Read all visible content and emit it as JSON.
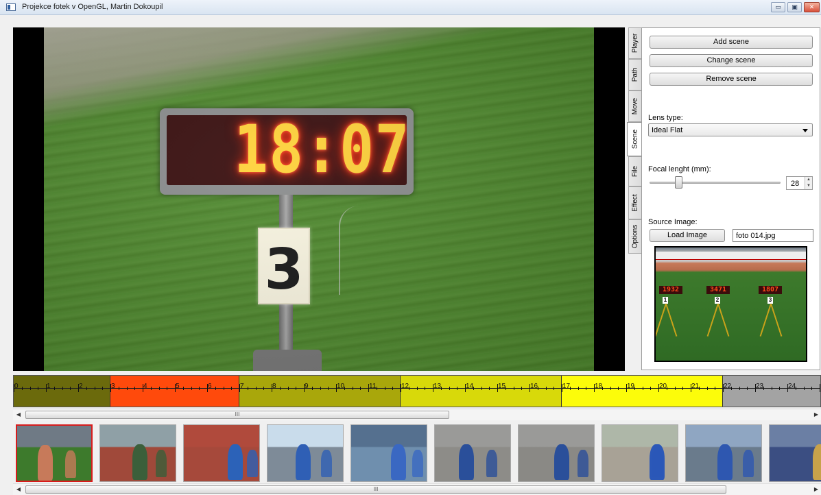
{
  "window": {
    "title": "Projekce fotek v OpenGL, Martin Dokoupil",
    "controls": {
      "minimize": "▭",
      "maximize": "▣",
      "close": "✕"
    }
  },
  "viewport": {
    "clock_digits": "18:07",
    "card_number": "3"
  },
  "tabs": [
    "Player",
    "Path",
    "Move",
    "Scene",
    "File",
    "Effect",
    "Options"
  ],
  "active_tab": "Scene",
  "scene": {
    "add_label": "Add scene",
    "change_label": "Change scene",
    "remove_label": "Remove scene",
    "lens_type_label": "Lens type:",
    "lens_type_value": "Ideal Flat",
    "focal_label": "Focal lenght (mm):",
    "focal_value": "28",
    "focal_fraction": 0.22,
    "source_label": "Source Image:",
    "load_label": "Load Image",
    "source_file": "foto 014.jpg",
    "preview": {
      "boards": [
        "1932",
        "3471",
        "1807"
      ],
      "cards": [
        "1",
        "2",
        "3"
      ]
    }
  },
  "timeline": {
    "ticks": [
      "0",
      "1",
      "2",
      "3",
      "4",
      "5",
      "6",
      "7",
      "8",
      "9",
      "10",
      "11",
      "12",
      "13",
      "14",
      "15",
      "16",
      "17",
      "18",
      "19",
      "20",
      "21",
      "22",
      "23",
      "24",
      "2"
    ],
    "segments": [
      {
        "start": 0,
        "end": 3,
        "color": "#6b6a0c"
      },
      {
        "start": 3,
        "end": 7,
        "color": "#ff4a0c"
      },
      {
        "start": 7,
        "end": 12,
        "color": "#a9a70b"
      },
      {
        "start": 12,
        "end": 17,
        "color": "#d8d90a"
      },
      {
        "start": 17,
        "end": 22,
        "color": "#fcfc0a"
      },
      {
        "start": 22,
        "end": 25.2,
        "color": "#a3a3a3"
      }
    ],
    "scroll_fraction": 0.0
  },
  "thumbnails": [
    {
      "selected": true,
      "sky": "#6f7a85",
      "ground": "#3d7a2c",
      "accent": "#c77a5a"
    },
    {
      "selected": false,
      "sky": "#8fa0a6",
      "ground": "#a0493a",
      "accent": "#3b5f3a"
    },
    {
      "selected": false,
      "sky": "#b04a3c",
      "ground": "#a6493b",
      "accent": "#2c62b8"
    },
    {
      "selected": false,
      "sky": "#c9dceb",
      "ground": "#7e8b98",
      "accent": "#2f5fb5"
    },
    {
      "selected": false,
      "sky": "#55708f",
      "ground": "#6f8fae",
      "accent": "#3a68c2"
    },
    {
      "selected": false,
      "sky": "#9a9a98",
      "ground": "#8d8c88",
      "accent": "#2a4f9a"
    },
    {
      "selected": false,
      "sky": "#9a9a98",
      "ground": "#8a8985",
      "accent": "#2a4f9a"
    },
    {
      "selected": false,
      "sky": "#aeb7a8",
      "ground": "#a8a296",
      "accent": "#2b58b8"
    },
    {
      "selected": false,
      "sky": "#8fa6c2",
      "ground": "#6a7b8c",
      "accent": "#2e57b0"
    },
    {
      "selected": false,
      "sky": "#6b7fa4",
      "ground": "#3b4e82",
      "accent": "#c8a24a"
    }
  ],
  "scrollbars": {
    "grip": "III"
  },
  "colors": {
    "window_bg": "#f0f0f0",
    "selection": "#d81b1b"
  }
}
